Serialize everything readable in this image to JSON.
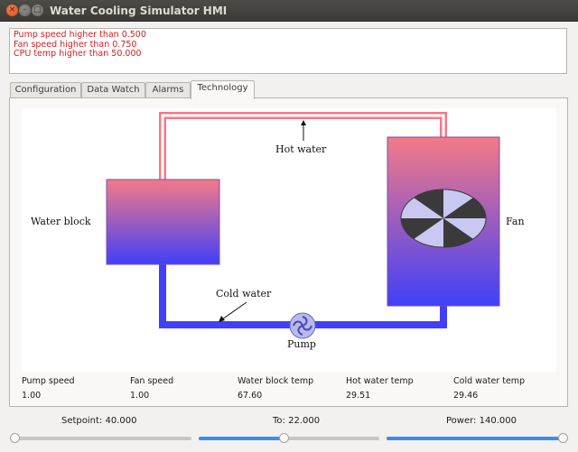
{
  "window": {
    "title": "Water Cooling Simulator HMI"
  },
  "log": {
    "lines": [
      "Pump speed higher than 0.500",
      "Fan speed higher than 0.750",
      "CPU temp higher than 50.000"
    ]
  },
  "tabs": [
    {
      "label": "Configuration",
      "active": false
    },
    {
      "label": "Data Watch",
      "active": false
    },
    {
      "label": "Alarms",
      "active": false
    },
    {
      "label": "Technology",
      "active": true
    }
  ],
  "diagram": {
    "labels": {
      "hot_water": "Hot water",
      "cold_water": "Cold water",
      "water_block": "Water block",
      "fan": "Fan",
      "pump": "Pump"
    },
    "colors": {
      "hot": "#f47a86",
      "cold": "#4040f8",
      "fan_blade_dark": "#3a3a3a",
      "fan_blade_light": "#c8c8f0"
    }
  },
  "readouts": [
    {
      "label": "Pump speed",
      "value": "1.00"
    },
    {
      "label": "Fan speed",
      "value": "1.00"
    },
    {
      "label": "Water block temp",
      "value": "67.60"
    },
    {
      "label": "Hot water temp",
      "value": "29.51"
    },
    {
      "label": "Cold water temp",
      "value": "29.46"
    }
  ],
  "sliders": {
    "setpoint": {
      "text": "Setpoint:  40.000",
      "level": 0.0
    },
    "to": {
      "text": "To:  22.000",
      "level": 0.47
    },
    "power": {
      "text": "Power:  140.000",
      "level": 1.0
    }
  },
  "accent_color": "#3d8ee6"
}
